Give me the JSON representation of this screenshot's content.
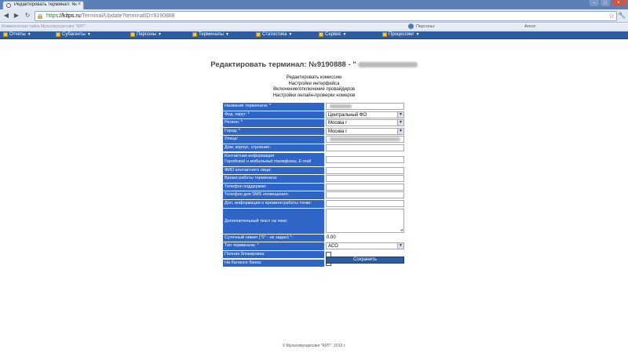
{
  "browser": {
    "tab_title": "Редактировать терминал: №",
    "tab_close": "×",
    "url_scheme": "https",
    "url_host": "://kitps.ru",
    "url_path": "/Terminal/Update?terminalID=9190888"
  },
  "site_header": {
    "company": "Коммерческая тайна Мультипроцессинг \"КИТ\"",
    "persons_label": "Персоны:",
    "admin_label": "Агент:"
  },
  "menu": [
    {
      "label": "Отчеты"
    },
    {
      "label": "Субагенты"
    },
    {
      "label": "Персоны"
    },
    {
      "label": "Терминалы"
    },
    {
      "label": "Статистика"
    },
    {
      "label": "Сервис"
    },
    {
      "label": "Процессинг"
    }
  ],
  "page": {
    "title": "Редактировать терминал: №9190888 - \"",
    "links": [
      "Редактировать комиссию",
      "Настройки интерфейса",
      "Включение/отключение провайдеров",
      "Настройки онлайн-проверки номеров"
    ]
  },
  "form": {
    "name_label": "Название терминала: *",
    "fed_label": "Фед. округ: *",
    "fed_value": "Центральный ФО",
    "region_label": "Регион: *",
    "region_value": "Москва г",
    "city_label": "Город: *",
    "city_value": "Москва г",
    "street_label": "Улица:",
    "house_label": "Дом, корпус, строение:",
    "contact_label": "Контактная информация",
    "contact_sub": "Городской и мобильный телефоны, E-mail",
    "fio_label": "ФИО контактного лица:",
    "worktime_label": "Время работы терминала:",
    "support_label": "Телефон поддержки:",
    "sms_label": "Телефон для SMS оповещения:",
    "extra_info_label": "Доп. информация о времени работы точки:",
    "extra_text_label": "Дополнительный текст на чеке:",
    "limit_label": "Суточный лимит (\"0\" - не задан) *:",
    "limit_value": "0.00",
    "type_label": "Тип терминала: *",
    "type_value": "АСО",
    "block_label": "Полная блокировка:",
    "bank_label": "На балансе банка:",
    "save_label": "Сохранить"
  },
  "footer": "© Мультипроцессинг \"КИТ\", 2012 г."
}
